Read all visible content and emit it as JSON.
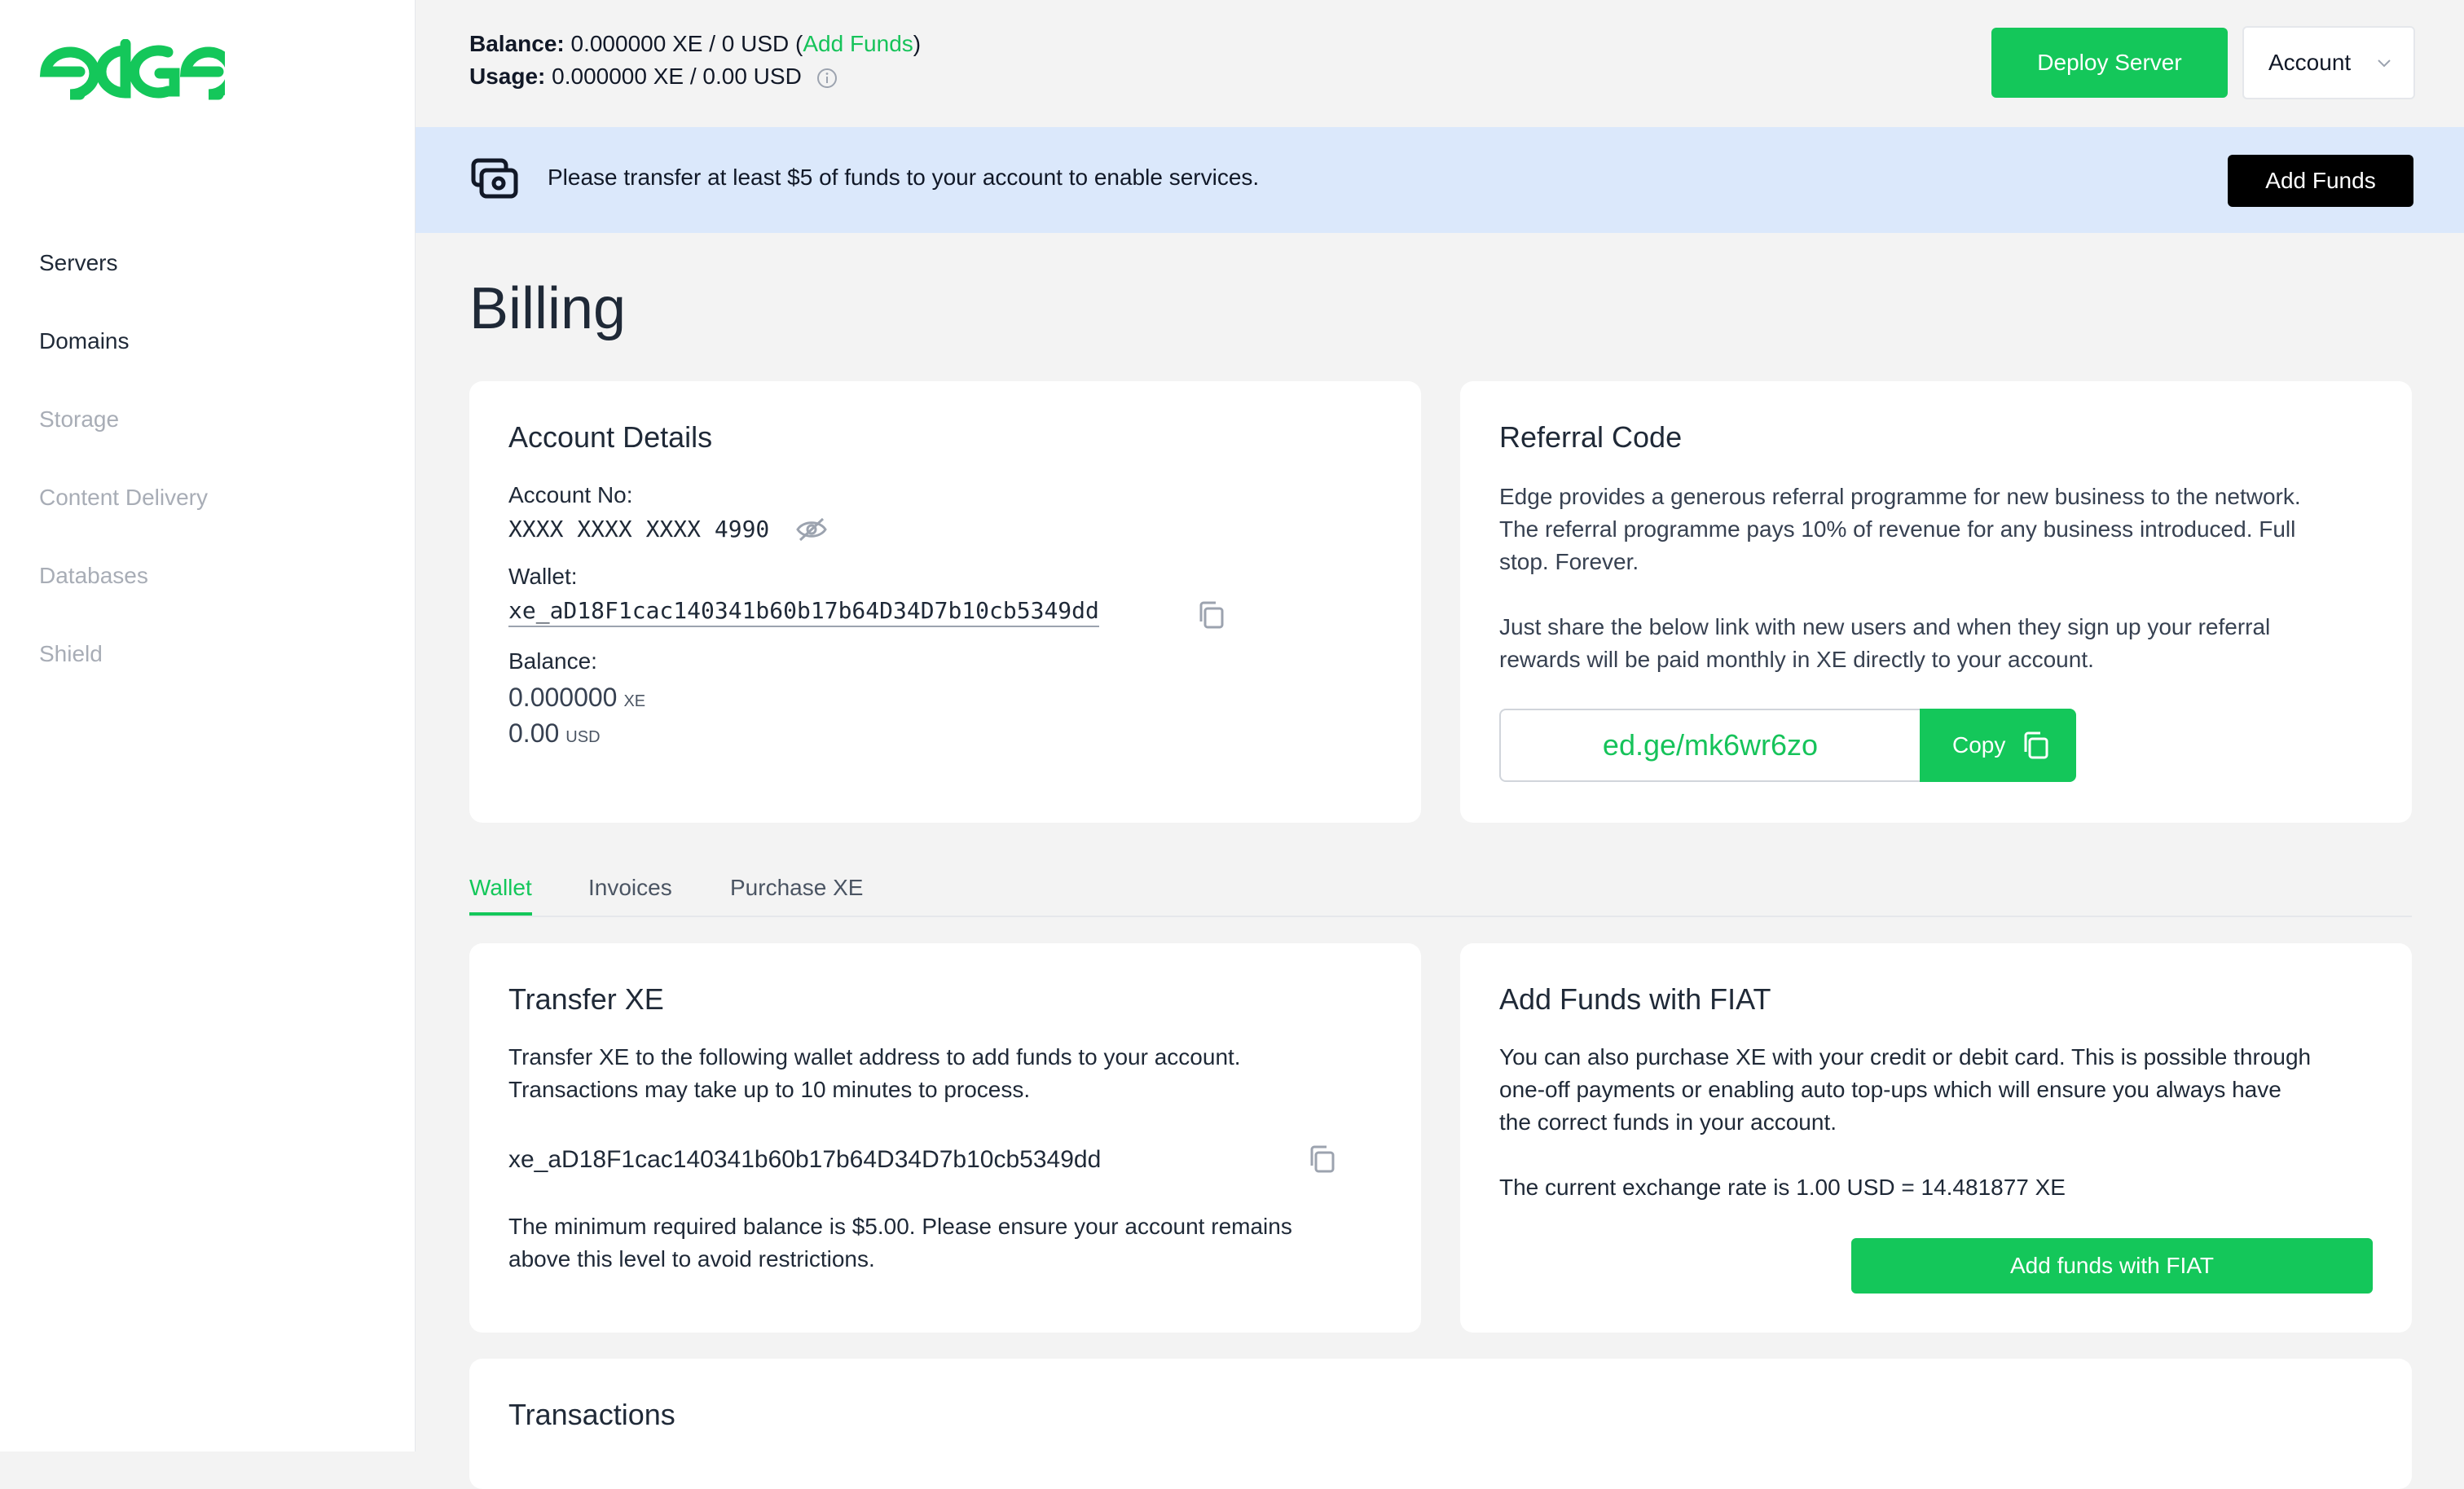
{
  "brand": {
    "logo_text": "edge",
    "accent": "#14c75a"
  },
  "sidebar": {
    "items": [
      {
        "label": "Servers",
        "enabled": true
      },
      {
        "label": "Domains",
        "enabled": true
      },
      {
        "label": "Storage",
        "enabled": false
      },
      {
        "label": "Content Delivery",
        "enabled": false
      },
      {
        "label": "Databases",
        "enabled": false
      },
      {
        "label": "Shield",
        "enabled": false
      }
    ]
  },
  "header": {
    "balance_label": "Balance:",
    "balance_value": "0.000000 XE / 0 USD",
    "add_funds_link": "Add Funds",
    "usage_label": "Usage:",
    "usage_value": "0.000000 XE / 0.00 USD",
    "deploy_button": "Deploy Server",
    "account_button": "Account"
  },
  "banner": {
    "message": "Please transfer at least $5 of funds to your account to enable services.",
    "button": "Add Funds"
  },
  "page": {
    "title": "Billing"
  },
  "account_details": {
    "title": "Account Details",
    "account_no_label": "Account No:",
    "account_no_value": "XXXX XXXX XXXX 4990",
    "wallet_label": "Wallet:",
    "wallet_value": "xe_aD18F1cac140341b60b17b64D34D7b10cb5349dd",
    "balance_label": "Balance:",
    "balance_xe": "0.000000",
    "balance_xe_unit": "XE",
    "balance_usd": "0.00",
    "balance_usd_unit": "USD"
  },
  "referral": {
    "title": "Referral Code",
    "para1_line1": "Edge provides a generous referral programme for new business to the network.",
    "para1_line2": "The referral programme pays 10% of revenue for any business introduced. Full",
    "para1_line3": "stop. Forever.",
    "para2_line1": "Just share the below link with new users and when they sign up your referral",
    "para2_line2": "rewards will be paid monthly in XE directly to your account.",
    "link": "ed.ge/mk6wr6zo",
    "copy_button": "Copy"
  },
  "tabs": [
    {
      "label": "Wallet",
      "active": true
    },
    {
      "label": "Invoices",
      "active": false
    },
    {
      "label": "Purchase XE",
      "active": false
    }
  ],
  "transfer": {
    "title": "Transfer XE",
    "desc_line1": "Transfer XE to the following wallet address to add funds to your account.",
    "desc_line2": "Transactions may take up to 10 minutes to process.",
    "address": "xe_aD18F1cac140341b60b17b64D34D7b10cb5349dd",
    "note_line1": "The minimum required balance is $5.00. Please ensure your account remains",
    "note_line2": "above this level to avoid restrictions."
  },
  "fiat": {
    "title": "Add Funds with FIAT",
    "desc_line1": "You can also purchase XE with your credit or debit card. This is possible through",
    "desc_line2": "one-off payments or enabling auto top-ups which will ensure you always have",
    "desc_line3": "the correct funds in your account.",
    "rate": "The current exchange rate is 1.00 USD = 14.481877 XE",
    "button": "Add funds with FIAT"
  },
  "transactions": {
    "title": "Transactions"
  }
}
